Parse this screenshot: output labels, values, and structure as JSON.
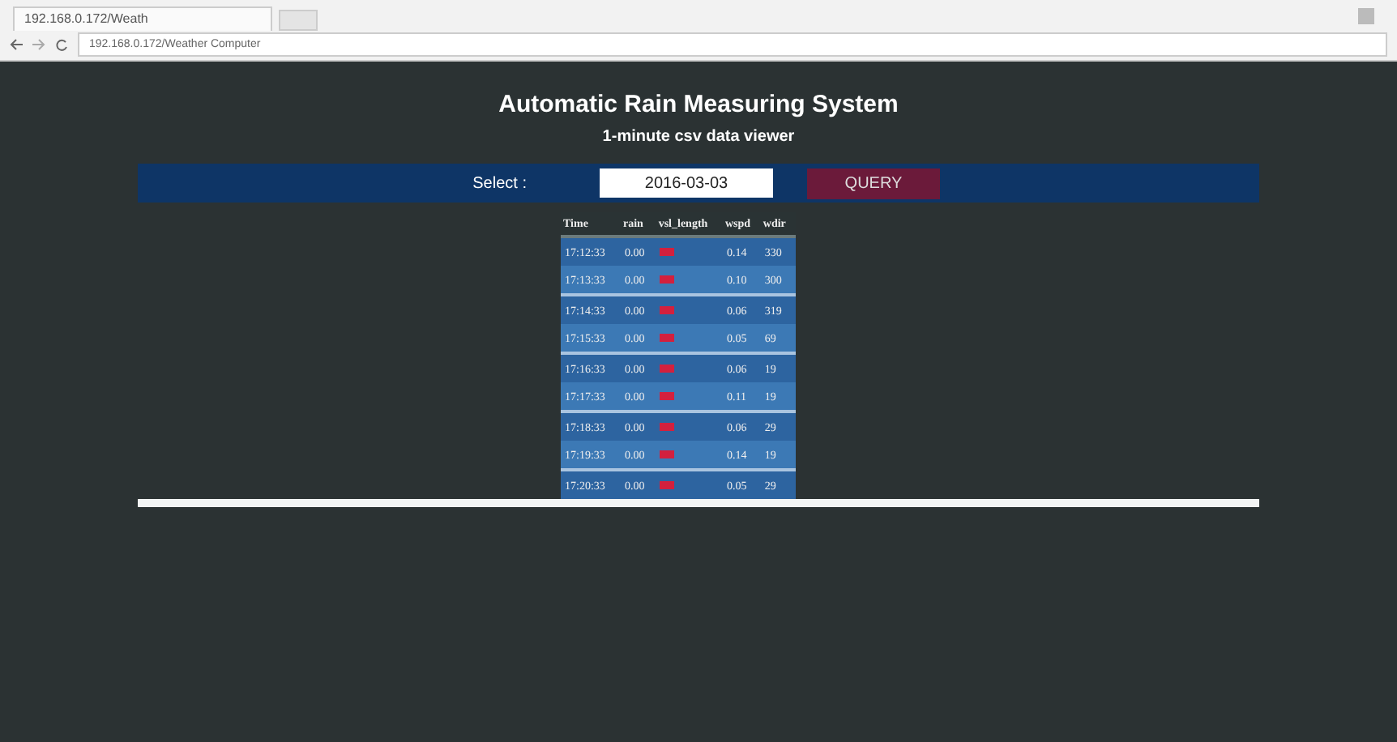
{
  "browser": {
    "tab_title": "192.168.0.172/Weath",
    "address": "192.168.0.172/Weather Computer"
  },
  "page": {
    "title": "Automatic Rain Measuring System",
    "subtitle": "1-minute csv data viewer"
  },
  "query_bar": {
    "label": "Select :",
    "date": "2016-03-03",
    "button": "QUERY"
  },
  "table": {
    "columns": [
      "Time",
      "rain",
      "vsl_length",
      "wspd",
      "wdir"
    ],
    "rows": [
      {
        "time": "17:12:33",
        "rain": "0.00",
        "flag": true,
        "wspd": "0.14",
        "wdir": "330"
      },
      {
        "time": "17:13:33",
        "rain": "0.00",
        "flag": true,
        "wspd": "0.10",
        "wdir": "300"
      },
      {
        "time": "17:14:33",
        "rain": "0.00",
        "flag": true,
        "wspd": "0.06",
        "wdir": "319"
      },
      {
        "time": "17:15:33",
        "rain": "0.00",
        "flag": true,
        "wspd": "0.05",
        "wdir": "69"
      },
      {
        "time": "17:16:33",
        "rain": "0.00",
        "flag": true,
        "wspd": "0.06",
        "wdir": "19"
      },
      {
        "time": "17:17:33",
        "rain": "0.00",
        "flag": true,
        "wspd": "0.11",
        "wdir": "19"
      },
      {
        "time": "17:18:33",
        "rain": "0.00",
        "flag": true,
        "wspd": "0.06",
        "wdir": "29"
      },
      {
        "time": "17:19:33",
        "rain": "0.00",
        "flag": true,
        "wspd": "0.14",
        "wdir": "19"
      },
      {
        "time": "17:20:33",
        "rain": "0.00",
        "flag": true,
        "wspd": "0.05",
        "wdir": "29"
      }
    ]
  }
}
